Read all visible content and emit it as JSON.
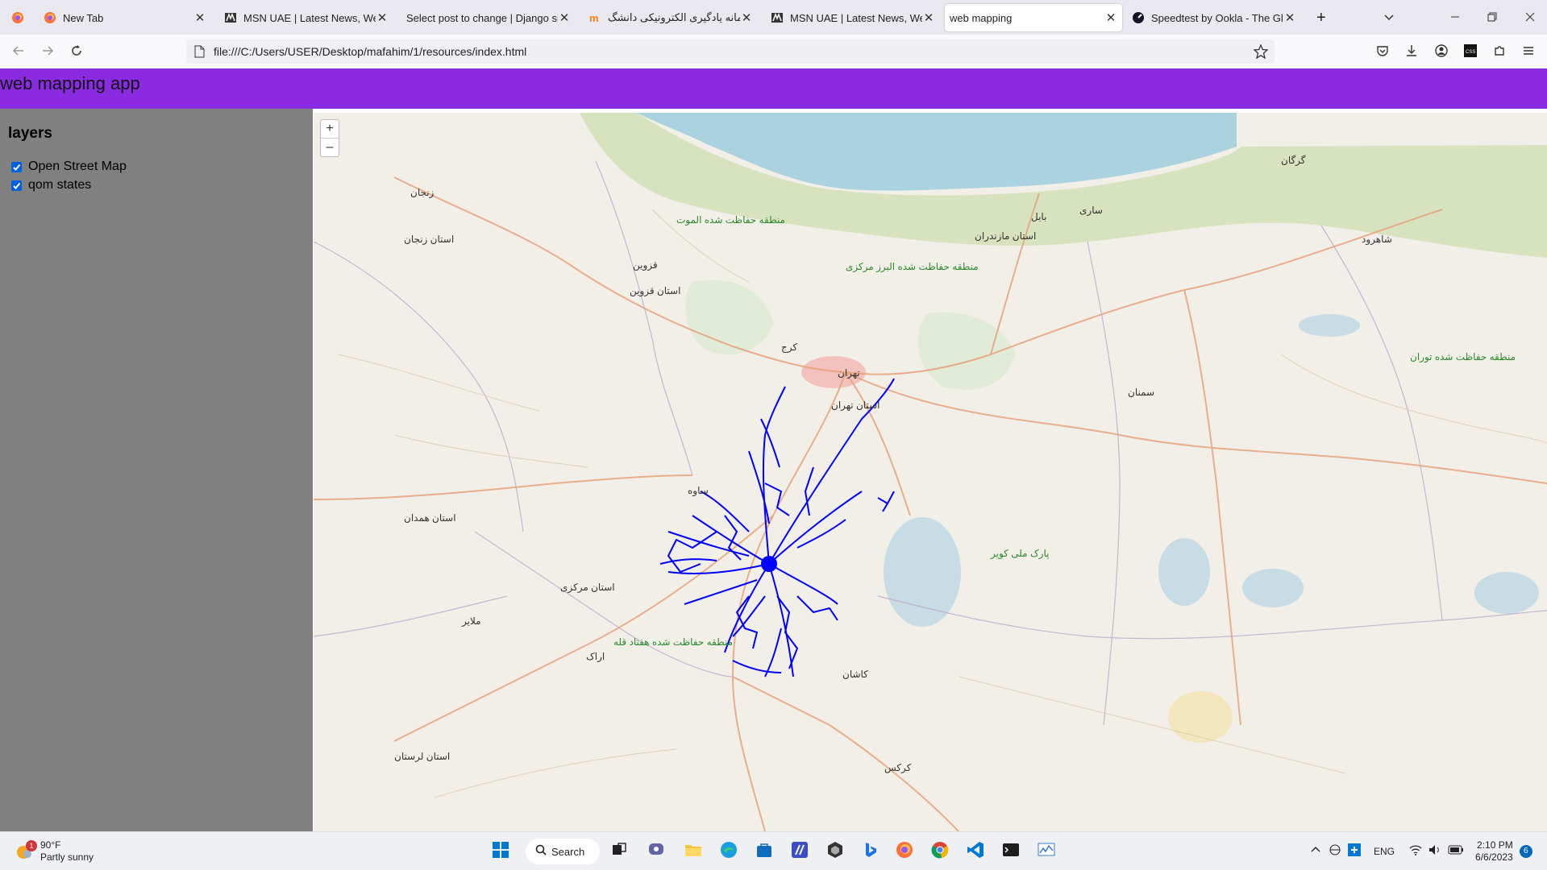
{
  "browser": {
    "tabs": [
      {
        "title": "",
        "icon": "firefox-icon",
        "active": false
      },
      {
        "title": "New Tab",
        "icon": "firefox-icon",
        "active": false
      },
      {
        "title": "MSN UAE | Latest News, Weath",
        "icon": "msn-icon",
        "active": false
      },
      {
        "title": "Select post to change | Django site",
        "icon": "",
        "active": false
      },
      {
        "title": "سامانه یادگیری الکترونیکی دانشگ",
        "icon": "moodle-icon",
        "active": false
      },
      {
        "title": "MSN UAE | Latest News, Weath",
        "icon": "msn-icon",
        "active": false
      },
      {
        "title": "web mapping",
        "icon": "",
        "active": true
      },
      {
        "title": "Speedtest by Ookla - The Globa",
        "icon": "speedtest-icon",
        "active": false
      }
    ],
    "url": "file:///C:/Users/USER/Desktop/mafahim/1/resources/index.html"
  },
  "app": {
    "title": "web mapping app"
  },
  "sidebar": {
    "heading": "layers",
    "layers": [
      {
        "label": "Open Street Map",
        "checked": true
      },
      {
        "label": "qom states",
        "checked": true
      }
    ]
  },
  "map": {
    "zoom_in": "+",
    "zoom_out": "–",
    "overlay_color": "#0000ff",
    "labels": [
      "زنجان",
      "استان زنجان",
      "قزوین",
      "استان قزوین",
      "کرج",
      "تهران",
      "استان تهران",
      "ساری",
      "بابل",
      "گرگان",
      "استان مازندران",
      "شاهرود",
      "سمنان",
      "ساوه",
      "استان همدان",
      "استان مرکزی",
      "اراک",
      "ملایر",
      "کاشان",
      "کرکس",
      "استان لرستان",
      "منطقه حفاظت شده البرز مرکزی",
      "پارک ملی کویر",
      "منطقه حفاظت شده توران",
      "منطقه حفاظت شده هفتاد قله",
      "منطقه حفاظت شده الموت"
    ]
  },
  "taskbar": {
    "weather_temp": "90°F",
    "weather_desc": "Partly sunny",
    "weather_badge": "1",
    "search_label": "Search",
    "lang": "ENG",
    "time": "2:10 PM",
    "date": "6/6/2023",
    "notif_count": "6"
  }
}
